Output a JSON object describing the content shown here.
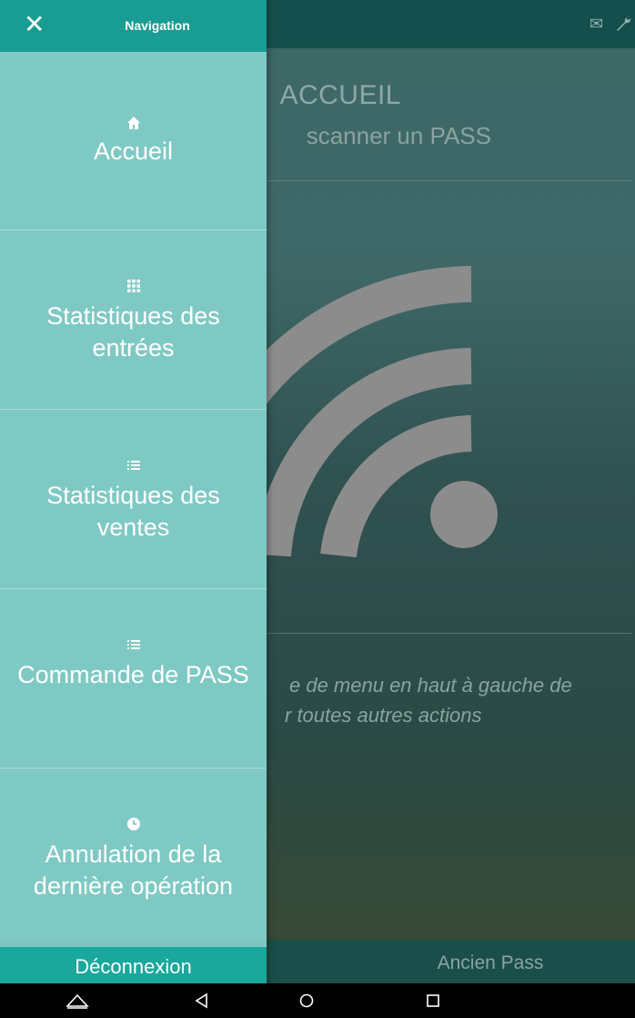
{
  "drawer": {
    "title": "Navigation",
    "close_icon": "close-icon",
    "items": [
      {
        "icon": "home-icon",
        "glyph": "🏠",
        "label": "Accueil"
      },
      {
        "icon": "grid-icon",
        "glyph": "⠿",
        "label": "Statistiques des entrées"
      },
      {
        "icon": "list-icon",
        "glyph": "≔",
        "label": "Statistiques des ventes"
      },
      {
        "icon": "list-icon",
        "glyph": "≔",
        "label": "Commande de PASS"
      },
      {
        "icon": "clock-icon",
        "glyph": "◷",
        "label": "Annulation de la dernière opération"
      }
    ],
    "logout_label": "Déconnexion"
  },
  "main": {
    "title": "ACCUEIL",
    "subtitle": "scanner un PASS",
    "hint": "e de menu en haut à gauche de r toutes autres actions",
    "hint_line1": "e de menu en haut à gauche de",
    "hint_line2": "r toutes autres actions",
    "bottom_button": "Ancien Pass",
    "topbar_icons": [
      "mail-icon",
      "wrench-icon"
    ]
  },
  "colors": {
    "drawer_bg": "#7dc6c2",
    "drawer_header": "#199c92",
    "main_topbar": "#154f4d"
  }
}
